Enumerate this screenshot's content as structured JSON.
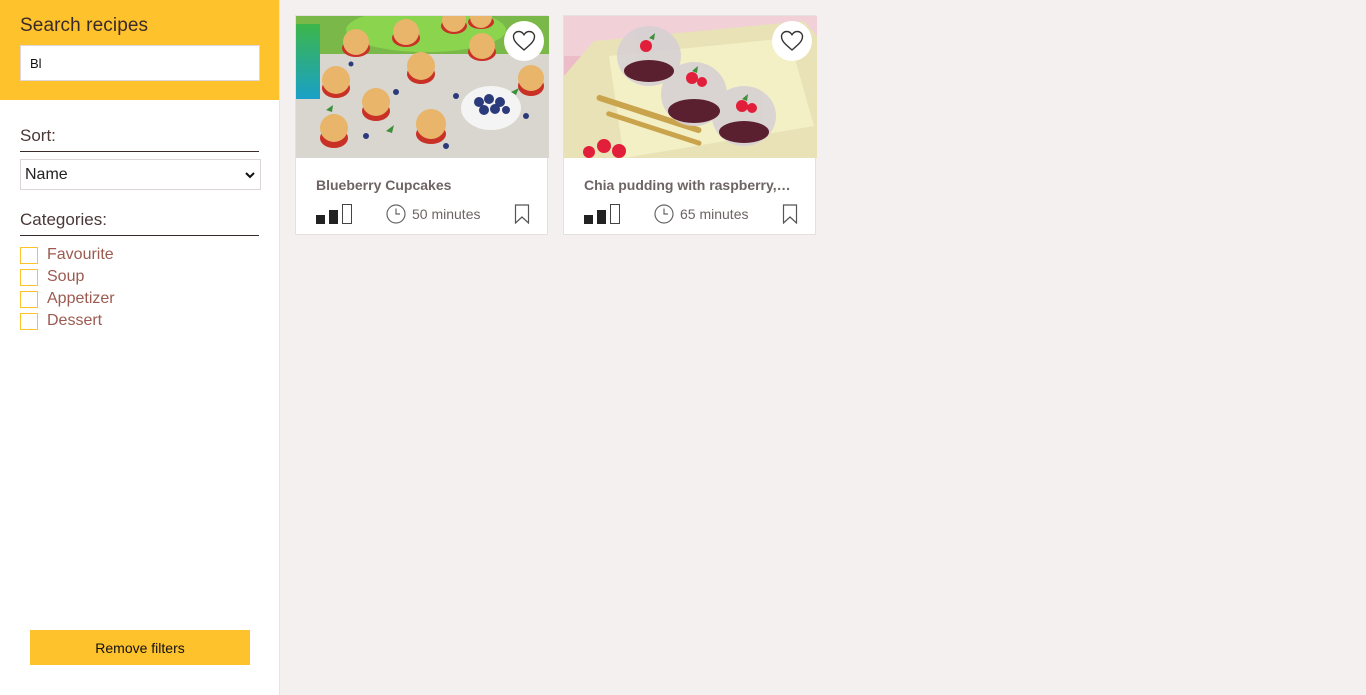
{
  "sidebar": {
    "search_title": "Search recipes",
    "search_value": "Bl",
    "sort_title": "Sort:",
    "sort_selected": "Name",
    "categories_title": "Categories:",
    "categories": [
      {
        "label": "Favourite",
        "checked": false
      },
      {
        "label": "Soup",
        "checked": false
      },
      {
        "label": "Appetizer",
        "checked": false
      },
      {
        "label": "Dessert",
        "checked": false
      }
    ],
    "remove_filters_label": "Remove filters"
  },
  "recipes": [
    {
      "title": "Blueberry Cupcakes",
      "time": "50 minutes",
      "difficulty": "2 of 3",
      "image_icon": "blueberry-cupcakes-photo"
    },
    {
      "title": "Chia pudding with raspberry,blu…",
      "time": "65 minutes",
      "difficulty": "2 of 3",
      "image_icon": "chia-pudding-photo"
    }
  ],
  "colors": {
    "accent": "#fec22c",
    "background": "#f4f0f0",
    "category_text": "#9c5a50"
  }
}
